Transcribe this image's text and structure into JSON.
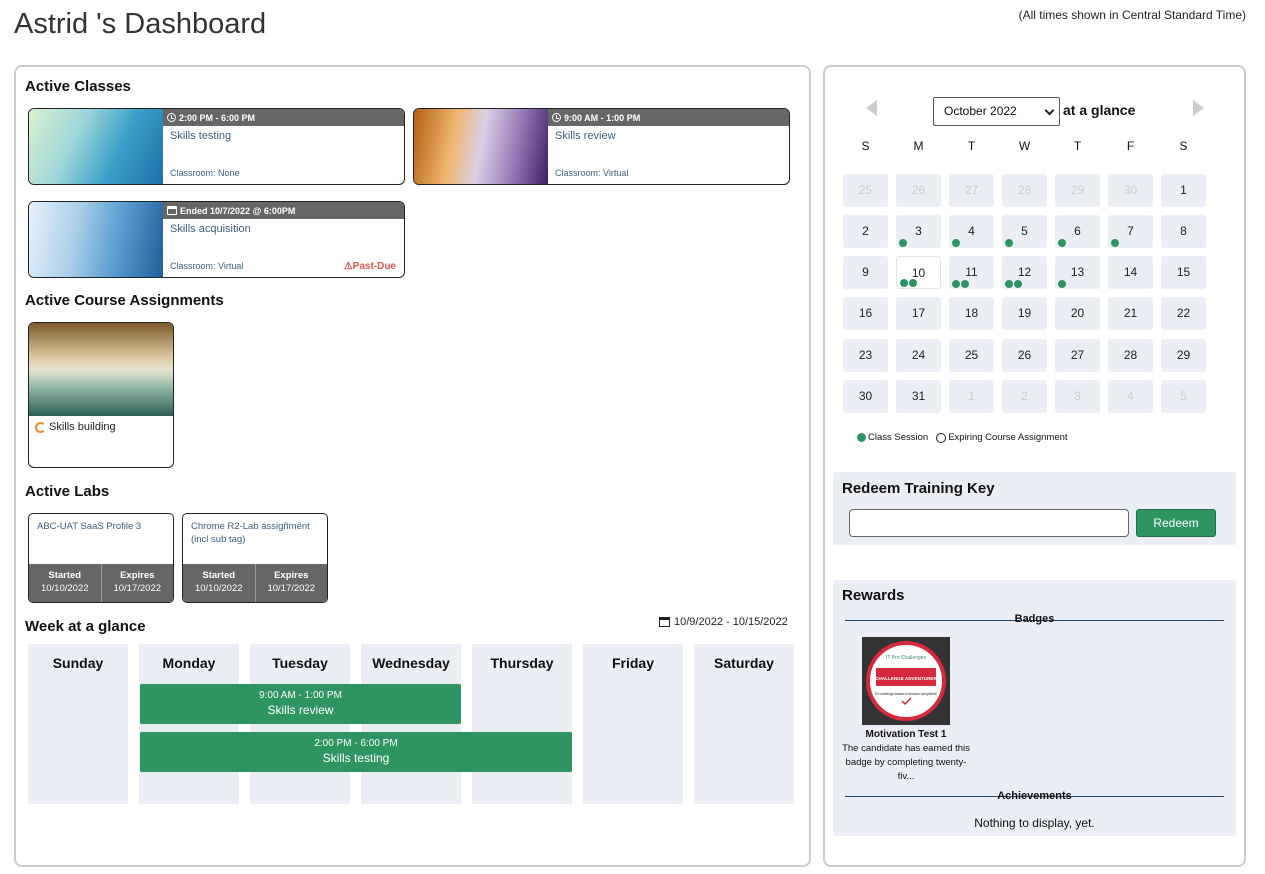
{
  "header": {
    "title": "Astrid 's Dashboard",
    "timezone_note": "(All times shown in Central Standard Time)"
  },
  "active_classes": {
    "heading": "Active Classes",
    "items": [
      {
        "time": "2:00 PM - 6:00 PM",
        "name": "Skills testing",
        "classroom": "Classroom: None",
        "status": ""
      },
      {
        "time": "9:00 AM - 1:00 PM",
        "name": "Skills review",
        "classroom": "Classroom: Virtual",
        "status": ""
      },
      {
        "time": "Ended 10/7/2022 @ 6:00PM",
        "name": "Skills acquisition",
        "classroom": "Classroom: Virtual",
        "status": "⚠Past-Due"
      }
    ]
  },
  "course_assignments": {
    "heading": "Active Course Assignments",
    "items": [
      {
        "name": "Skills building"
      }
    ]
  },
  "labs": {
    "heading": "Active Labs",
    "items": [
      {
        "name": "ABC-UAT SaaS Profile 3",
        "started_label": "Started",
        "started": "10/10/2022",
        "expires_label": "Expires",
        "expires": "10/17/2022"
      },
      {
        "name": "Chrome R2-Lab ássigñmënt (incl sub tag)",
        "started_label": "Started",
        "started": "10/10/2022",
        "expires_label": "Expires",
        "expires": "10/17/2022"
      }
    ]
  },
  "week": {
    "heading": "Week at a glance",
    "range": "10/9/2022 - 10/15/2022",
    "days": [
      "Sunday",
      "Monday",
      "Tuesday",
      "Wednesday",
      "Thursday",
      "Friday",
      "Saturday"
    ],
    "events": [
      {
        "time": "9:00 AM - 1:00 PM",
        "name": "Skills review"
      },
      {
        "time": "2:00 PM - 6:00 PM",
        "name": "Skills testing"
      }
    ]
  },
  "calendar": {
    "month": "October 2022",
    "suffix": "at a glance",
    "weekdays": [
      "S",
      "M",
      "T",
      "W",
      "T",
      "F",
      "S"
    ],
    "weeks": [
      [
        {
          "d": "25",
          "o": true,
          "n": 0
        },
        {
          "d": "26",
          "o": true,
          "n": 0
        },
        {
          "d": "27",
          "o": true,
          "n": 0
        },
        {
          "d": "28",
          "o": true,
          "n": 0
        },
        {
          "d": "29",
          "o": true,
          "n": 0
        },
        {
          "d": "30",
          "o": true,
          "n": 0
        },
        {
          "d": "1",
          "o": false,
          "n": 0
        }
      ],
      [
        {
          "d": "2",
          "o": false,
          "n": 0
        },
        {
          "d": "3",
          "o": false,
          "n": 1
        },
        {
          "d": "4",
          "o": false,
          "n": 1
        },
        {
          "d": "5",
          "o": false,
          "n": 1
        },
        {
          "d": "6",
          "o": false,
          "n": 1
        },
        {
          "d": "7",
          "o": false,
          "n": 1
        },
        {
          "d": "8",
          "o": false,
          "n": 0
        }
      ],
      [
        {
          "d": "9",
          "o": false,
          "n": 0
        },
        {
          "d": "10",
          "o": false,
          "n": 2,
          "today": true
        },
        {
          "d": "11",
          "o": false,
          "n": 2
        },
        {
          "d": "12",
          "o": false,
          "n": 2
        },
        {
          "d": "13",
          "o": false,
          "n": 1
        },
        {
          "d": "14",
          "o": false,
          "n": 0
        },
        {
          "d": "15",
          "o": false,
          "n": 0
        }
      ],
      [
        {
          "d": "16",
          "o": false,
          "n": 0
        },
        {
          "d": "17",
          "o": false,
          "n": 0
        },
        {
          "d": "18",
          "o": false,
          "n": 0
        },
        {
          "d": "19",
          "o": false,
          "n": 0
        },
        {
          "d": "20",
          "o": false,
          "n": 0
        },
        {
          "d": "21",
          "o": false,
          "n": 0
        },
        {
          "d": "22",
          "o": false,
          "n": 0
        }
      ],
      [
        {
          "d": "23",
          "o": false,
          "n": 0
        },
        {
          "d": "24",
          "o": false,
          "n": 0
        },
        {
          "d": "25",
          "o": false,
          "n": 0
        },
        {
          "d": "26",
          "o": false,
          "n": 0
        },
        {
          "d": "27",
          "o": false,
          "n": 0
        },
        {
          "d": "28",
          "o": false,
          "n": 0
        },
        {
          "d": "29",
          "o": false,
          "n": 0
        }
      ],
      [
        {
          "d": "30",
          "o": false,
          "n": 0
        },
        {
          "d": "31",
          "o": false,
          "n": 0
        },
        {
          "d": "1",
          "o": true,
          "n": 0
        },
        {
          "d": "2",
          "o": true,
          "n": 0
        },
        {
          "d": "3",
          "o": true,
          "n": 0
        },
        {
          "d": "4",
          "o": true,
          "n": 0
        },
        {
          "d": "5",
          "o": true,
          "n": 0
        }
      ]
    ],
    "legend_session": "Class Session",
    "legend_expiring": "Expiring Course Assignment"
  },
  "redeem": {
    "title": "Redeem Training Key",
    "input_value": "",
    "button": "Redeem"
  },
  "rewards": {
    "title": "Rewards",
    "badges_label": "Badges",
    "badge": {
      "img_top": "IT Pro Challenges",
      "img_banner": "CHALLENGE ADVENTURER",
      "img_bottom": "25 challenge-based exercises completed!",
      "name": "Motivation Test 1",
      "description": "The candidate has earned this badge by completing twenty-fiv..."
    },
    "achievements_label": "Achievements",
    "achievements_empty": "Nothing to display, yet."
  },
  "colors": {
    "accent_green": "#2e9462",
    "header_gray": "#666666",
    "panel_bg": "#eceef6",
    "past_due_red": "#d9534f"
  }
}
